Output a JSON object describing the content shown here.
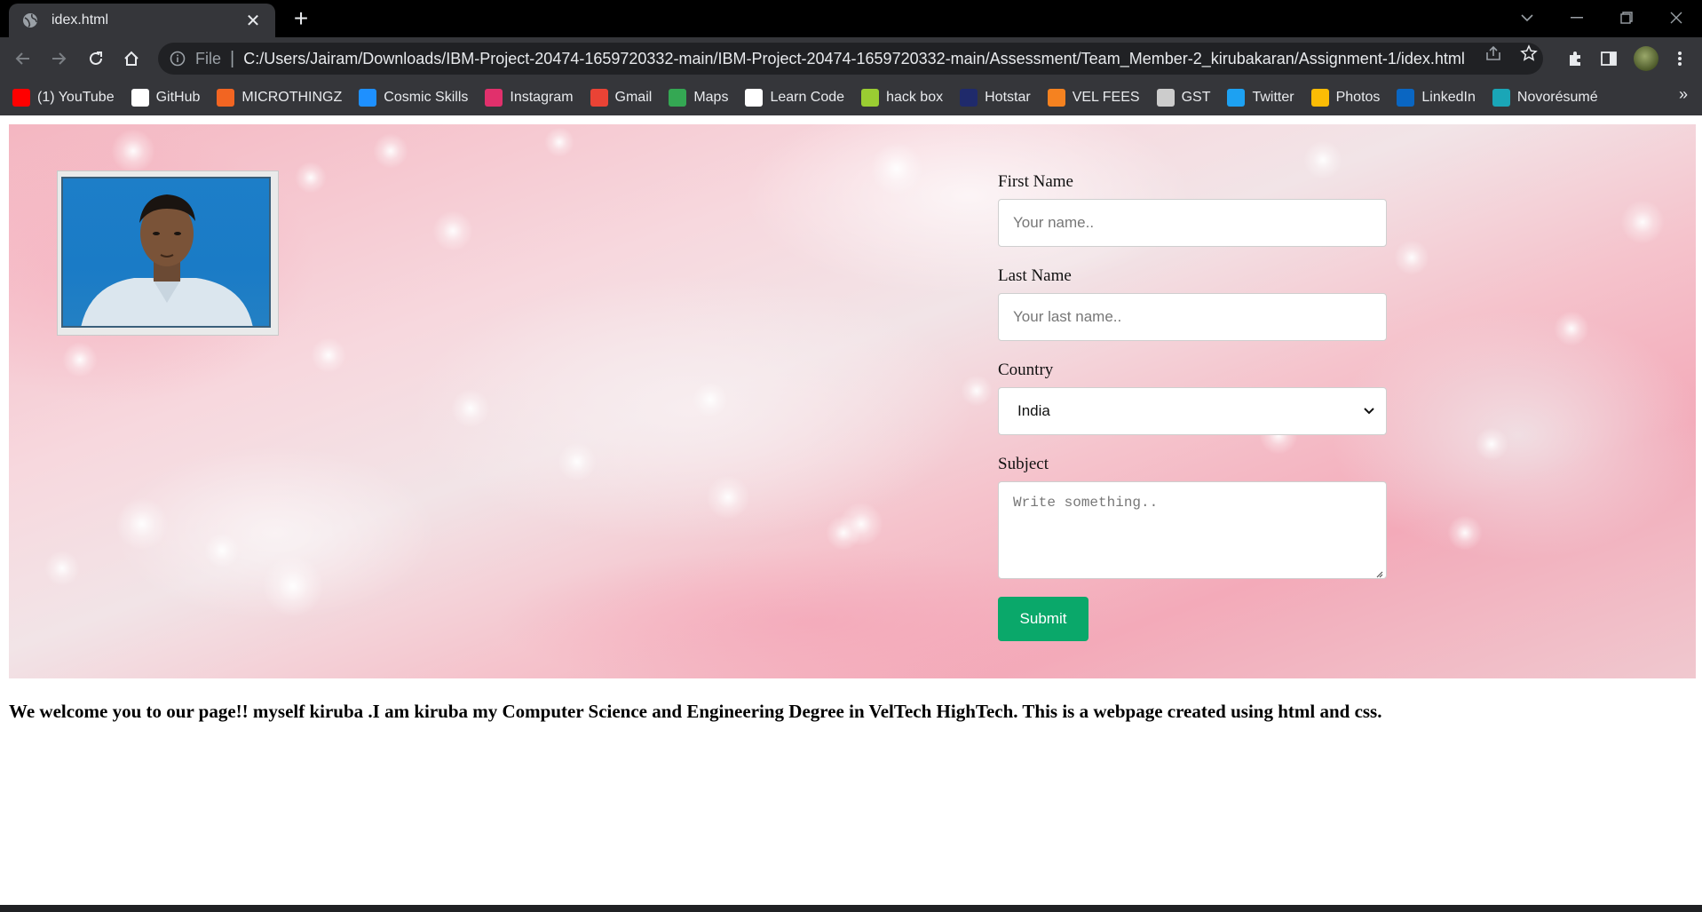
{
  "browser": {
    "tab_title": "idex.html",
    "url_scheme": "File",
    "url": "C:/Users/Jairam/Downloads/IBM-Project-20474-1659720332-main/IBM-Project-20474-1659720332-main/Assessment/Team_Member-2_kirubakaran/Assignment-1/idex.html",
    "bookmarks": [
      {
        "label": "(1) YouTube",
        "icon": "youtube-icon",
        "color": "#ff0000"
      },
      {
        "label": "GitHub",
        "icon": "github-icon",
        "color": "#ffffff"
      },
      {
        "label": "MICROTHINGZ",
        "icon": "microthingz-icon",
        "color": "#f26522"
      },
      {
        "label": "Cosmic Skills",
        "icon": "cosmic-skills-icon",
        "color": "#1e90ff"
      },
      {
        "label": "Instagram",
        "icon": "instagram-icon",
        "color": "#e1306c"
      },
      {
        "label": "Gmail",
        "icon": "gmail-icon",
        "color": "#ea4335"
      },
      {
        "label": "Maps",
        "icon": "maps-icon",
        "color": "#34a853"
      },
      {
        "label": "Learn Code",
        "icon": "learn-code-icon",
        "color": "#ffffff"
      },
      {
        "label": "hack box",
        "icon": "hack-box-icon",
        "color": "#9acd32"
      },
      {
        "label": "Hotstar",
        "icon": "hotstar-icon",
        "color": "#1f2a6b"
      },
      {
        "label": "VEL FEES",
        "icon": "vel-fees-icon",
        "color": "#f58220"
      },
      {
        "label": "GST",
        "icon": "gst-icon",
        "color": "#cccccc"
      },
      {
        "label": "Twitter",
        "icon": "twitter-icon",
        "color": "#1da1f2"
      },
      {
        "label": "Photos",
        "icon": "photos-icon",
        "color": "#fbbc05"
      },
      {
        "label": "LinkedIn",
        "icon": "linkedin-icon",
        "color": "#0a66c2"
      },
      {
        "label": "Novorésumé",
        "icon": "novoresume-icon",
        "color": "#1aa6b7"
      }
    ],
    "more_bookmarks": "»"
  },
  "page": {
    "form": {
      "first_name_label": "First Name",
      "first_name_placeholder": "Your name..",
      "last_name_label": "Last Name",
      "last_name_placeholder": "Your last name..",
      "country_label": "Country",
      "country_value": "India",
      "subject_label": "Subject",
      "subject_placeholder": "Write something..",
      "submit_label": "Submit"
    },
    "welcome_text": "We welcome you to our page!! myself kiruba .I am kiruba my Computer Science and Engineering Degree in VelTech HighTech. This is a webpage created using html and css."
  },
  "colors": {
    "submit_button": "#0aa86a",
    "hero_pink": "#f4b6c1"
  }
}
